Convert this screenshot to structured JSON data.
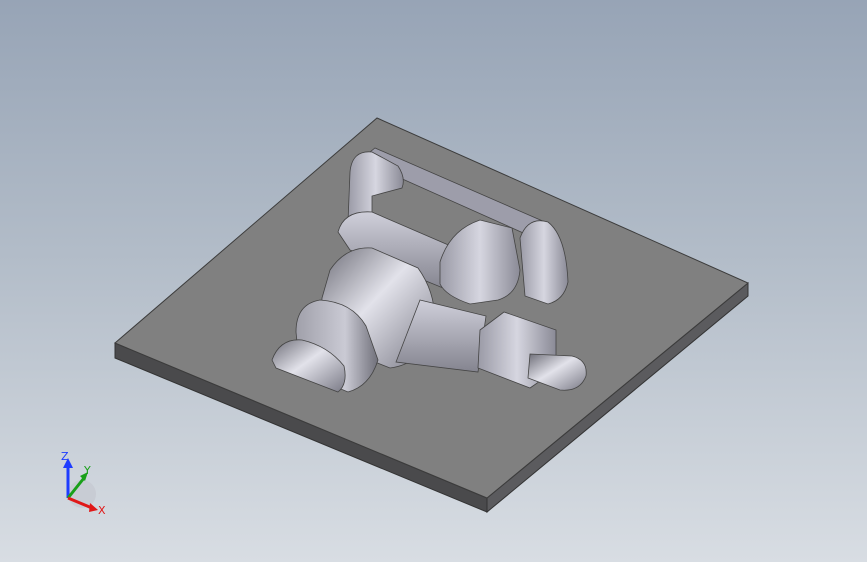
{
  "view": {
    "colors": {
      "background_top": "#97a4b6",
      "background_bottom": "#d8dde3",
      "plate_top": "#808080",
      "part_shade": "#8f8f9a",
      "part_highlight": "#dcdce6"
    }
  },
  "triad": {
    "z_label": "Z",
    "y_label": "Y",
    "x_label": "X",
    "z_color": "#1e3cff",
    "y_color": "#19a019",
    "x_color": "#e01818"
  }
}
